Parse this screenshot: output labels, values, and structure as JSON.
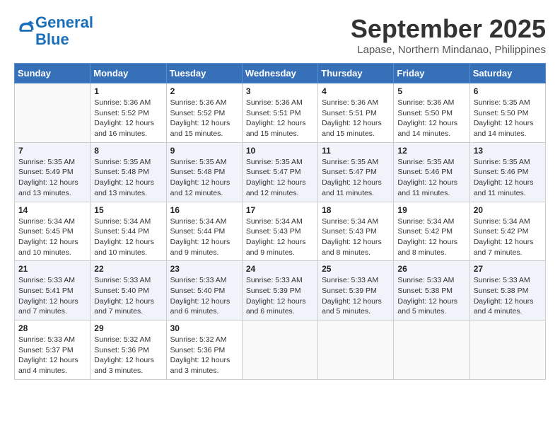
{
  "header": {
    "logo_line1": "General",
    "logo_line2": "Blue",
    "month": "September 2025",
    "location": "Lapase, Northern Mindanao, Philippines"
  },
  "weekdays": [
    "Sunday",
    "Monday",
    "Tuesday",
    "Wednesday",
    "Thursday",
    "Friday",
    "Saturday"
  ],
  "weeks": [
    [
      {
        "day": "",
        "info": ""
      },
      {
        "day": "1",
        "info": "Sunrise: 5:36 AM\nSunset: 5:52 PM\nDaylight: 12 hours\nand 16 minutes."
      },
      {
        "day": "2",
        "info": "Sunrise: 5:36 AM\nSunset: 5:52 PM\nDaylight: 12 hours\nand 15 minutes."
      },
      {
        "day": "3",
        "info": "Sunrise: 5:36 AM\nSunset: 5:51 PM\nDaylight: 12 hours\nand 15 minutes."
      },
      {
        "day": "4",
        "info": "Sunrise: 5:36 AM\nSunset: 5:51 PM\nDaylight: 12 hours\nand 15 minutes."
      },
      {
        "day": "5",
        "info": "Sunrise: 5:36 AM\nSunset: 5:50 PM\nDaylight: 12 hours\nand 14 minutes."
      },
      {
        "day": "6",
        "info": "Sunrise: 5:35 AM\nSunset: 5:50 PM\nDaylight: 12 hours\nand 14 minutes."
      }
    ],
    [
      {
        "day": "7",
        "info": "Sunrise: 5:35 AM\nSunset: 5:49 PM\nDaylight: 12 hours\nand 13 minutes."
      },
      {
        "day": "8",
        "info": "Sunrise: 5:35 AM\nSunset: 5:48 PM\nDaylight: 12 hours\nand 13 minutes."
      },
      {
        "day": "9",
        "info": "Sunrise: 5:35 AM\nSunset: 5:48 PM\nDaylight: 12 hours\nand 12 minutes."
      },
      {
        "day": "10",
        "info": "Sunrise: 5:35 AM\nSunset: 5:47 PM\nDaylight: 12 hours\nand 12 minutes."
      },
      {
        "day": "11",
        "info": "Sunrise: 5:35 AM\nSunset: 5:47 PM\nDaylight: 12 hours\nand 11 minutes."
      },
      {
        "day": "12",
        "info": "Sunrise: 5:35 AM\nSunset: 5:46 PM\nDaylight: 12 hours\nand 11 minutes."
      },
      {
        "day": "13",
        "info": "Sunrise: 5:35 AM\nSunset: 5:46 PM\nDaylight: 12 hours\nand 11 minutes."
      }
    ],
    [
      {
        "day": "14",
        "info": "Sunrise: 5:34 AM\nSunset: 5:45 PM\nDaylight: 12 hours\nand 10 minutes."
      },
      {
        "day": "15",
        "info": "Sunrise: 5:34 AM\nSunset: 5:44 PM\nDaylight: 12 hours\nand 10 minutes."
      },
      {
        "day": "16",
        "info": "Sunrise: 5:34 AM\nSunset: 5:44 PM\nDaylight: 12 hours\nand 9 minutes."
      },
      {
        "day": "17",
        "info": "Sunrise: 5:34 AM\nSunset: 5:43 PM\nDaylight: 12 hours\nand 9 minutes."
      },
      {
        "day": "18",
        "info": "Sunrise: 5:34 AM\nSunset: 5:43 PM\nDaylight: 12 hours\nand 8 minutes."
      },
      {
        "day": "19",
        "info": "Sunrise: 5:34 AM\nSunset: 5:42 PM\nDaylight: 12 hours\nand 8 minutes."
      },
      {
        "day": "20",
        "info": "Sunrise: 5:34 AM\nSunset: 5:42 PM\nDaylight: 12 hours\nand 7 minutes."
      }
    ],
    [
      {
        "day": "21",
        "info": "Sunrise: 5:33 AM\nSunset: 5:41 PM\nDaylight: 12 hours\nand 7 minutes."
      },
      {
        "day": "22",
        "info": "Sunrise: 5:33 AM\nSunset: 5:40 PM\nDaylight: 12 hours\nand 7 minutes."
      },
      {
        "day": "23",
        "info": "Sunrise: 5:33 AM\nSunset: 5:40 PM\nDaylight: 12 hours\nand 6 minutes."
      },
      {
        "day": "24",
        "info": "Sunrise: 5:33 AM\nSunset: 5:39 PM\nDaylight: 12 hours\nand 6 minutes."
      },
      {
        "day": "25",
        "info": "Sunrise: 5:33 AM\nSunset: 5:39 PM\nDaylight: 12 hours\nand 5 minutes."
      },
      {
        "day": "26",
        "info": "Sunrise: 5:33 AM\nSunset: 5:38 PM\nDaylight: 12 hours\nand 5 minutes."
      },
      {
        "day": "27",
        "info": "Sunrise: 5:33 AM\nSunset: 5:38 PM\nDaylight: 12 hours\nand 4 minutes."
      }
    ],
    [
      {
        "day": "28",
        "info": "Sunrise: 5:33 AM\nSunset: 5:37 PM\nDaylight: 12 hours\nand 4 minutes."
      },
      {
        "day": "29",
        "info": "Sunrise: 5:32 AM\nSunset: 5:36 PM\nDaylight: 12 hours\nand 3 minutes."
      },
      {
        "day": "30",
        "info": "Sunrise: 5:32 AM\nSunset: 5:36 PM\nDaylight: 12 hours\nand 3 minutes."
      },
      {
        "day": "",
        "info": ""
      },
      {
        "day": "",
        "info": ""
      },
      {
        "day": "",
        "info": ""
      },
      {
        "day": "",
        "info": ""
      }
    ]
  ]
}
